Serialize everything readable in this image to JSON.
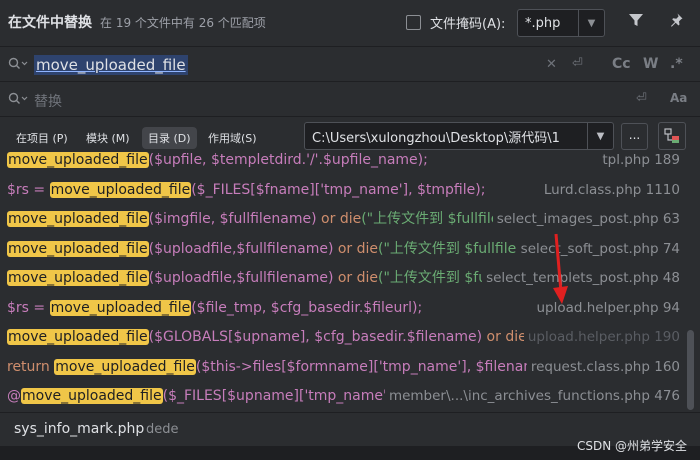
{
  "title_bar": {
    "title": "在文件中替换",
    "subtitle": "在 19 个文件中有 26 个匹配项",
    "file_mask_label": "文件掩码(A):",
    "file_mask_value": "*.php"
  },
  "search": {
    "query": "move_uploaded_file",
    "replace_placeholder": "替换"
  },
  "search_options": {
    "case": "Cc",
    "word": "W",
    "regex": ".*"
  },
  "scope": {
    "tabs": [
      {
        "label": "在项目 (P)"
      },
      {
        "label": "模块 (M)"
      },
      {
        "label": "目录 (D)"
      },
      {
        "label": "作用域(S)"
      }
    ],
    "active_tab": "目录 (D)",
    "directory": "C:\\Users\\xulongzhou\\Desktop\\源代码\\1",
    "browse_label": "..."
  },
  "results": [
    {
      "file": "tpl.php 189"
    },
    {
      "file": "Lurd.class.php 1110"
    },
    {
      "file": "select_images_post.php 63"
    },
    {
      "file": "select_soft_post.php 74"
    },
    {
      "file": "select_templets_post.php 48"
    },
    {
      "file": "upload.helper.php 94"
    },
    {
      "file": "upload.helper.php 190"
    },
    {
      "file": "request.class.php 160"
    },
    {
      "file": "member\\...\\inc_archives_functions.php 476"
    }
  ],
  "code_text": {
    "r0_rest": "($upfile, $templetdird.'/'.$upfile_name);",
    "r1_pre": "$rs = ",
    "r1_rest": "($_FILES[$fname]['tmp_name'], $tmpfile);",
    "r2_rest_a": "($imgfile, $fullfilename) ",
    "r2_kw": "or die",
    "r2_str": "(\"上传文件到 $fullfilen",
    "r3_rest_a": "($uploadfile,$fullfilename) ",
    "r3_kw": "or die",
    "r3_str": "(\"上传文件到 $fullfilen",
    "r4_rest_a": "($uploadfile,$fullfilename) ",
    "r4_kw": "or die",
    "r4_str": "(\"上传文件到 $ful",
    "r5_pre": "$rs = ",
    "r5_rest": "($file_tmp, $cfg_basedir.$fileurl);",
    "r6_rest_a": "($GLOBALS[$upname], $cfg_basedir.$filename) ",
    "r6_kw": "or die(",
    "r7_kw": "return ",
    "r7_rest": "($this->files[$formname]['tmp_name'], $filename",
    "r8_pre": "@",
    "r8_rest": "($_FILES[$upname]['tmp_name'], "
  },
  "preview": {
    "file": "sys_info_mark.php",
    "dir": "dede"
  },
  "watermark": "CSDN @州弟学安全",
  "colors": {
    "background": "#2b2d30",
    "highlight": "#f0c648",
    "selection": "#2e436e",
    "variable": "#c77dbb",
    "keyword": "#cf8e6d",
    "string": "#6aab73",
    "arrow": "#e02020"
  }
}
